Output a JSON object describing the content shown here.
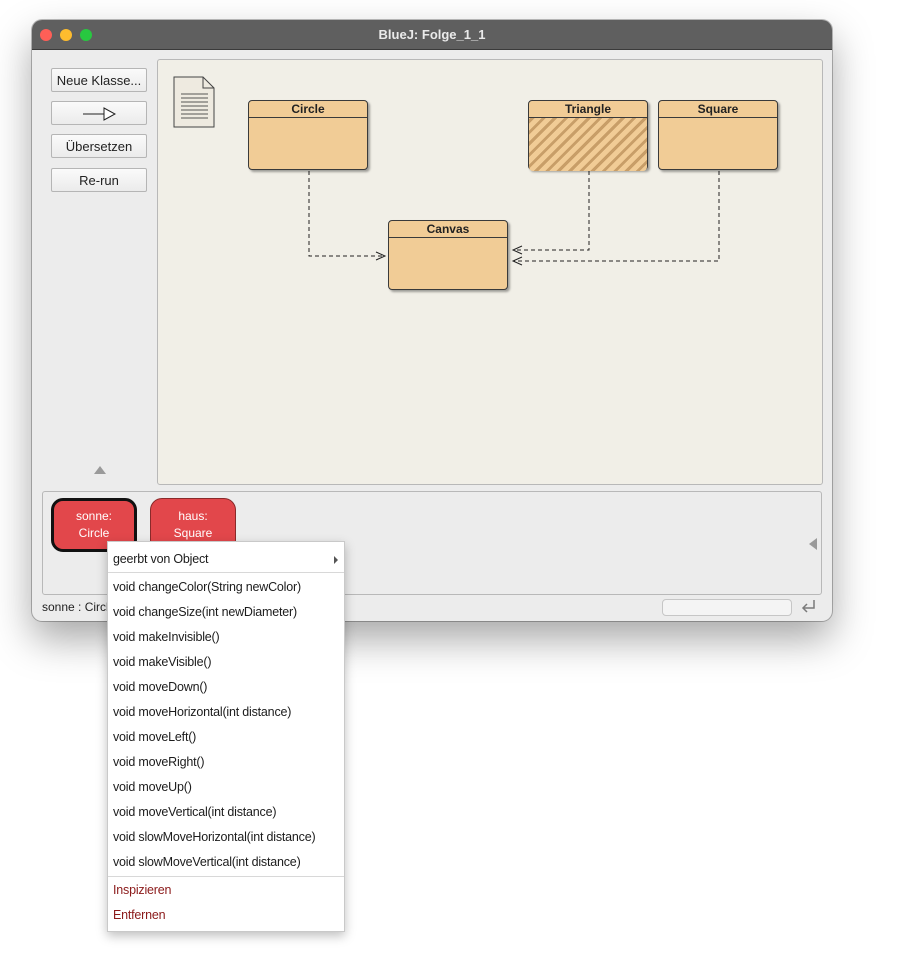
{
  "window": {
    "title": "BlueJ:  Folge_1_1"
  },
  "toolbar": {
    "new_class": "Neue Klasse...",
    "compile": "Übersetzen",
    "rerun": "Re-run",
    "arrow_icon": "inheritance-arrow-icon"
  },
  "classes": [
    {
      "name": "Circle",
      "hatched": false
    },
    {
      "name": "Triangle",
      "hatched": true
    },
    {
      "name": "Square",
      "hatched": false
    },
    {
      "name": "Canvas",
      "hatched": false
    }
  ],
  "objects": [
    {
      "name": "sonne:",
      "type": "Circle",
      "selected": true
    },
    {
      "name": "haus:",
      "type": "Square",
      "selected": false
    }
  ],
  "status": {
    "text": "sonne : Circle"
  },
  "context_menu": {
    "inherited": "geerbt von Object",
    "methods": [
      "void changeColor(String newColor)",
      "void changeSize(int newDiameter)",
      "void makeInvisible()",
      "void makeVisible()",
      "void moveDown()",
      "void moveHorizontal(int distance)",
      "void moveLeft()",
      "void moveRight()",
      "void moveUp()",
      "void moveVertical(int distance)",
      "void slowMoveHorizontal(int distance)",
      "void slowMoveVertical(int distance)"
    ],
    "inspect": "Inspizieren",
    "remove": "Entfernen"
  },
  "colors": {
    "class_fill": "#f1cc96",
    "object_fill": "#e2474b",
    "menu_red_text": "#8b1a1a"
  }
}
